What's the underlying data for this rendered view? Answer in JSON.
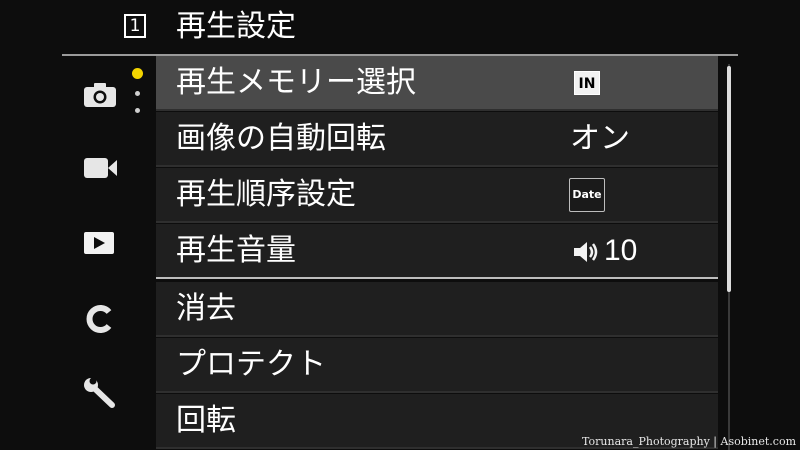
{
  "header": {
    "page_number": "1",
    "title": "再生設定"
  },
  "sidebar": {
    "items": [
      {
        "icon": "camera-icon",
        "active": false
      },
      {
        "icon": "video-icon",
        "active": false
      },
      {
        "icon": "playback-icon",
        "active": true
      },
      {
        "icon": "custom-c-icon",
        "active": false
      },
      {
        "icon": "wrench-icon",
        "active": false
      }
    ],
    "page_indicator": {
      "active_color": "#f3d400",
      "pages": 3,
      "current": 1
    }
  },
  "menu": {
    "items": [
      {
        "label": "再生メモリー選択",
        "value_badge": "IN",
        "selected": true
      },
      {
        "label": "画像の自動回転",
        "value": "オン"
      },
      {
        "label": "再生順序設定",
        "value_badge": "Date"
      },
      {
        "label": "再生音量",
        "value": "10",
        "value_icon": "speaker-icon"
      },
      {
        "label": "消去"
      },
      {
        "label": "プロテクト"
      },
      {
        "label": "回転"
      }
    ]
  },
  "colors": {
    "background": "#0d0d0d",
    "item_background": "#1f1f1f",
    "selected_background": "#4a4a4a",
    "accent": "#f3d400"
  },
  "watermark": "Torunara_Photography | Asobinet.com"
}
